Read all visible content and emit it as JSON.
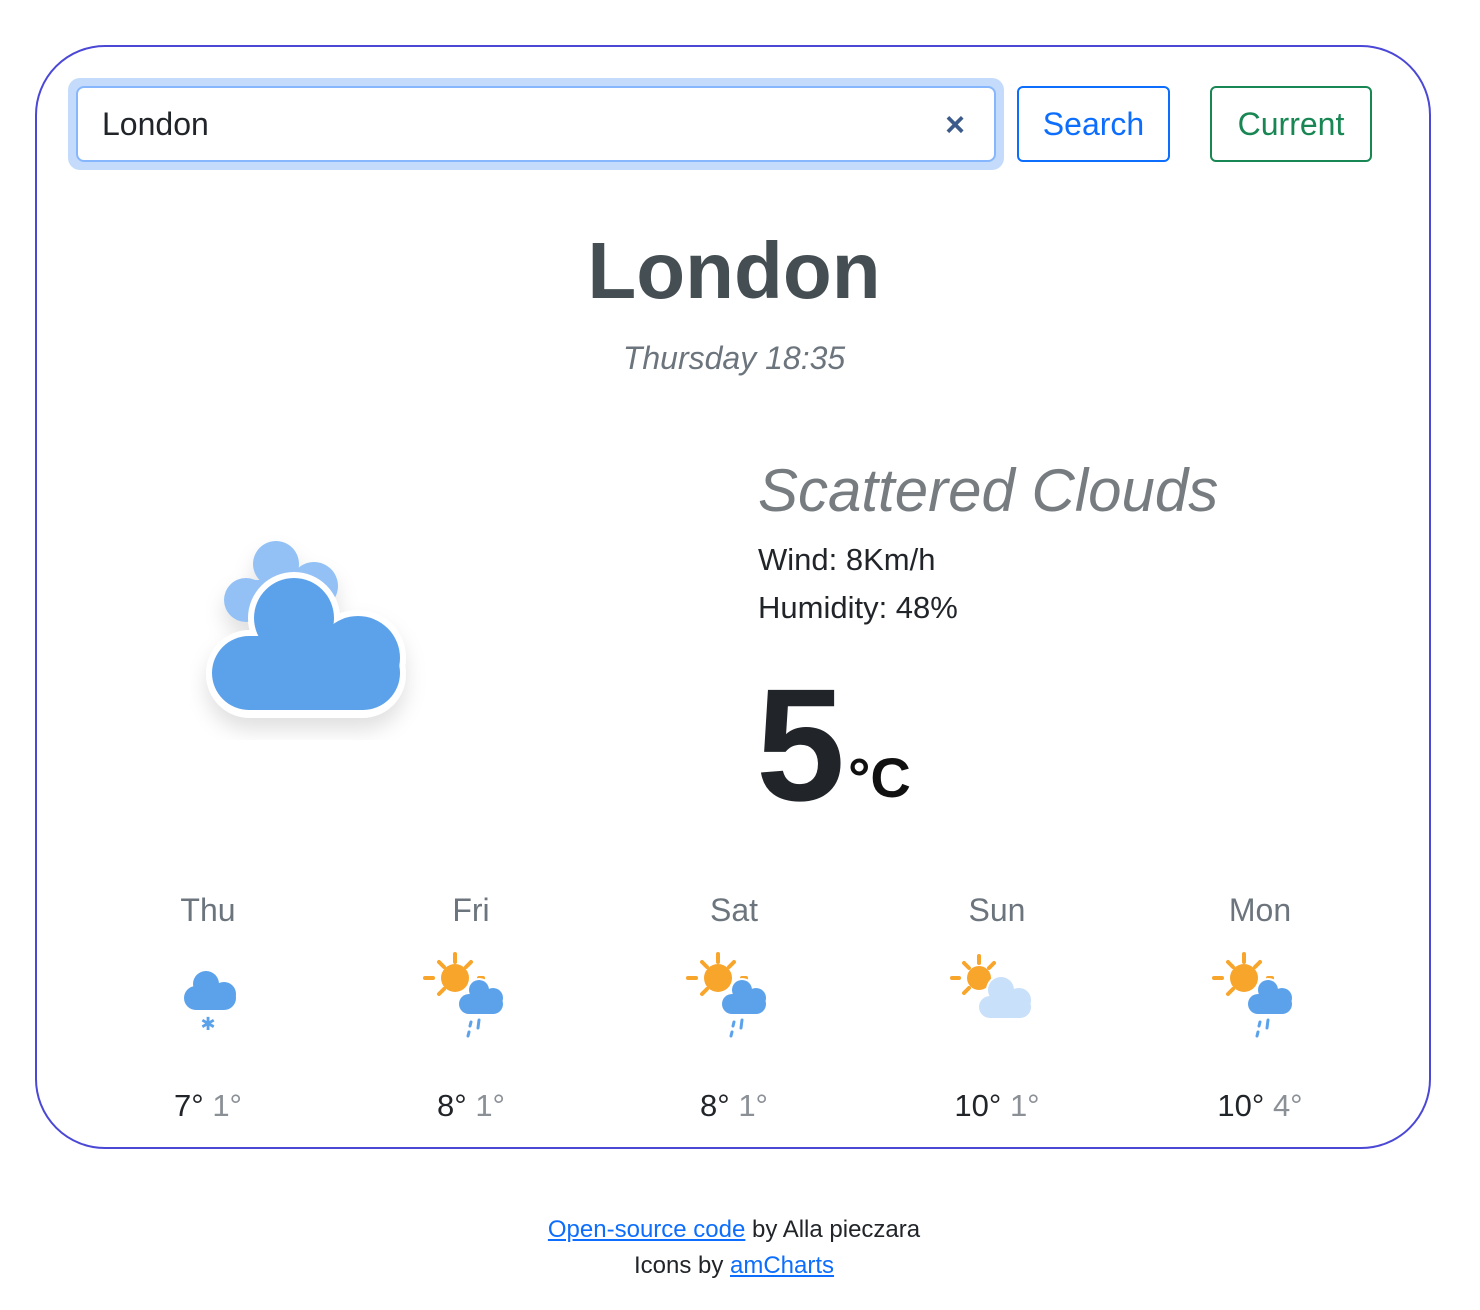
{
  "search": {
    "value": "London",
    "search_label": "Search",
    "current_label": "Current",
    "clear_icon": "×"
  },
  "current": {
    "city": "London",
    "datetime": "Thursday 18:35",
    "description": "Scattered Clouds",
    "wind": "Wind: 8Km/h",
    "humidity": "Humidity: 48%",
    "temperature": "5",
    "unit": "°C",
    "icon": "scattered-clouds-icon"
  },
  "forecast": [
    {
      "day": "Thu",
      "max": "7°",
      "min": "1°",
      "icon": "snow-cloud-icon"
    },
    {
      "day": "Fri",
      "max": "8°",
      "min": "1°",
      "icon": "sun-rain-cloud-icon"
    },
    {
      "day": "Sat",
      "max": "8°",
      "min": "1°",
      "icon": "sun-rain-cloud-icon"
    },
    {
      "day": "Sun",
      "max": "10°",
      "min": "1°",
      "icon": "sun-cloud-icon"
    },
    {
      "day": "Mon",
      "max": "10°",
      "min": "4°",
      "icon": "sun-rain-cloud-icon"
    }
  ],
  "footer": {
    "code_link": "Open-source code",
    "by_text": " by Alla pieczara",
    "icons_text": "Icons by ",
    "icons_link": "amCharts"
  },
  "colors": {
    "card_border": "#4b48d6",
    "cloud_blue": "#5ca2eb",
    "cloud_light": "#94c1f5",
    "sun_orange": "#f8a52c",
    "search_blue": "#0d6efd",
    "current_green": "#198754"
  }
}
